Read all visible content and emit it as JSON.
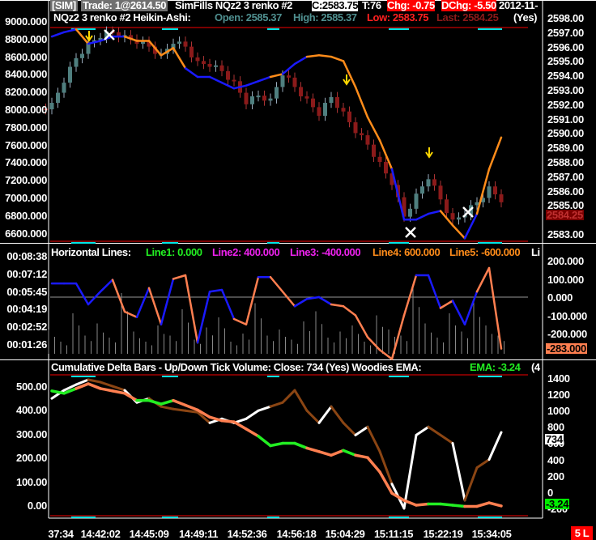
{
  "header": {
    "sim": "[SIM]",
    "trade": "Trade: 1@2614.50",
    "fills": "SimFills NQz2  3 renko  #2",
    "close": "C:2583.75",
    "ticks": "T:76",
    "chg": "Chg: -0.75",
    "dchg": "DChg: -5.50",
    "date": "2012-11-",
    "study_name": "NQz2  3 renko  #2 Heikin-Ashi:",
    "open": "Open: 2585.37",
    "high": "High: 2585.37",
    "low": "Low: 2583.75",
    "last": "Last: 2584.25",
    "yes": "(Yes)"
  },
  "mid_header": {
    "title": "Horizontal Lines:",
    "line1": "Line1: 0.000",
    "line2": "Line2: 400.000",
    "line3": "Line3: -400.000",
    "line4": "Line4: 600.000",
    "line5": "Line5: -600.000",
    "more": "Li"
  },
  "bottom_header": {
    "title": "Cumulative Delta Bars - Up/Down Tick Volume:  Close: 734   (Yes)  Woodies EMA:",
    "ema": "EMA: -3.24",
    "more": "(4"
  },
  "top_left_axis": [
    "9000.000",
    "8800.000",
    "8600.000",
    "8400.000",
    "8200.000",
    "8000.000",
    "7800.000",
    "7600.000",
    "7400.000",
    "7200.000",
    "7000.000",
    "6800.000",
    "6600.000"
  ],
  "top_right_axis": [
    "2598.00",
    "2597.00",
    "2596.00",
    "2595.00",
    "2594.00",
    "2593.00",
    "2592.00",
    "2591.00",
    "2590.00",
    "2589.00",
    "2588.00",
    "2587.00",
    "2586.00",
    "2585.00",
    "2583.00"
  ],
  "last_price_label": "2584.25",
  "mid_left_axis": [
    "00:08:38",
    "00:07:12",
    "00:05:45",
    "00:04:19",
    "00:02:52",
    "00:01:26"
  ],
  "mid_right_axis": [
    "200.000",
    "100.000",
    "0.000",
    "-100.000",
    "-200.000"
  ],
  "mid_value_label": "-283.000",
  "bottom_left_axis": [
    "500.00",
    "400.00",
    "300.00",
    "200.00",
    "100.00",
    "0.00"
  ],
  "bottom_right_axis": [
    "1400",
    "1200",
    "1000",
    "800",
    "600",
    "400",
    "200",
    "0",
    "-200"
  ],
  "close_label": "734",
  "ema_label": "-3.24",
  "time_axis": [
    "37:34",
    "14:42:02",
    "14:45:09",
    "14:49:11",
    "14:52:36",
    "14:56:18",
    "15:04:29",
    "15:11:15",
    "15:22:19",
    "15:34:05"
  ],
  "status_badge": "5 L",
  "colors": {
    "up": "#4f7f7f",
    "down": "#8b1a1a",
    "blue": "#1a1aff",
    "orange": "#ff8c1a",
    "white": "#ffffff",
    "brown": "#8b4513",
    "green": "#22ee22",
    "salmon": "#ff7f50"
  },
  "chart_data": [
    {
      "type": "candlestick",
      "name": "Heikin-Ashi renko",
      "ylim": [
        2582.5,
        2598.3
      ],
      "closes": [
        2592.1,
        2593.5,
        2595.2,
        2596.3,
        2596.6,
        2597.0,
        2596.8,
        2596.2,
        2596.0,
        2595.5,
        2596.2,
        2596.0,
        2595.0,
        2594.6,
        2594.3,
        2593.6,
        2592.0,
        2592.6,
        2592.4,
        2594.0,
        2593.2,
        2592.4,
        2591.2,
        2592.5,
        2591.5,
        2590.0,
        2589.2,
        2588.0,
        2586.4,
        2584.2,
        2585.8,
        2586.8,
        2585.4,
        2584.0,
        2584.3,
        2585.2,
        2586.3,
        2585.2
      ],
      "trend_line": {
        "values": [
          2596.7,
          2597.0,
          2597.2,
          2596.2,
          2596.4,
          2596.7,
          2596.7,
          2596.4,
          2596.4,
          2595.4,
          2595.9,
          2594.5,
          2593.9,
          2593.9,
          2593.5,
          2593.1,
          2593.3,
          2593.6,
          2593.9,
          2594.1,
          2594.8,
          2595.3,
          2595.4,
          2595.3,
          2595.0,
          2593.2,
          2591.1,
          2589.5,
          2587.5,
          2584.0,
          2584.0,
          2584.4,
          2584.6,
          2583.6,
          2582.7,
          2584.4,
          2587.5,
          2589.7
        ],
        "colors": "bbbobbbooooobbbbbbbobbooooooobbbbooboo"
      }
    },
    {
      "type": "line",
      "name": "Horizontal Lines study",
      "ylim": [
        -350,
        250
      ],
      "values": [
        75,
        75,
        75,
        -40,
        30,
        95,
        -80,
        -110,
        50,
        -150,
        100,
        120,
        -250,
        30,
        40,
        -120,
        -150,
        110,
        110,
        30,
        -50,
        -10,
        0,
        -40,
        -50,
        -100,
        -220,
        -290,
        -340,
        -100,
        120,
        120,
        -60,
        -20,
        -150,
        30,
        160,
        -283
      ],
      "colors": "bbbbbbooboboobbbooboobbbooooooobbobboo",
      "bar_durations_sec": [
        120,
        60,
        200,
        90,
        150,
        80,
        300,
        110,
        60,
        140,
        90,
        220,
        70,
        130,
        180,
        60,
        100,
        250,
        90,
        120,
        70,
        160,
        210,
        80,
        110,
        140,
        60,
        190,
        120,
        90,
        330,
        150,
        80,
        200,
        110,
        260,
        140,
        90
      ]
    },
    {
      "type": "line",
      "name": "Cumulative Delta / Woodies EMA",
      "delta": {
        "ylim": [
          -250,
          1450
        ],
        "values": [
          1150,
          1250,
          1320,
          1380,
          1350,
          1300,
          1250,
          1100,
          1150,
          1050,
          1020,
          1000,
          980,
          850,
          900,
          850,
          900,
          1000,
          1050,
          1100,
          1250,
          1000,
          850,
          1050,
          850,
          700,
          800,
          500,
          100,
          -200,
          700,
          800,
          700,
          600,
          -100,
          300,
          400,
          734
        ],
        "colors": "wwwwbbbwwbbbbbwwwwwbbbbwbbwbbwwwbbwbbw"
      },
      "ema": {
        "ylim": [
          -30,
          520
        ],
        "values": [
          480,
          470,
          490,
          510,
          490,
          480,
          470,
          440,
          440,
          425,
          440,
          420,
          400,
          370,
          355,
          350,
          320,
          290,
          250,
          260,
          260,
          240,
          225,
          210,
          230,
          210,
          200,
          140,
          50,
          20,
          0,
          5,
          5,
          0,
          -5,
          -5,
          10,
          -3.24
        ],
        "colors": "oggooooogggoooooooggggooogoooooogggooog"
      }
    }
  ]
}
